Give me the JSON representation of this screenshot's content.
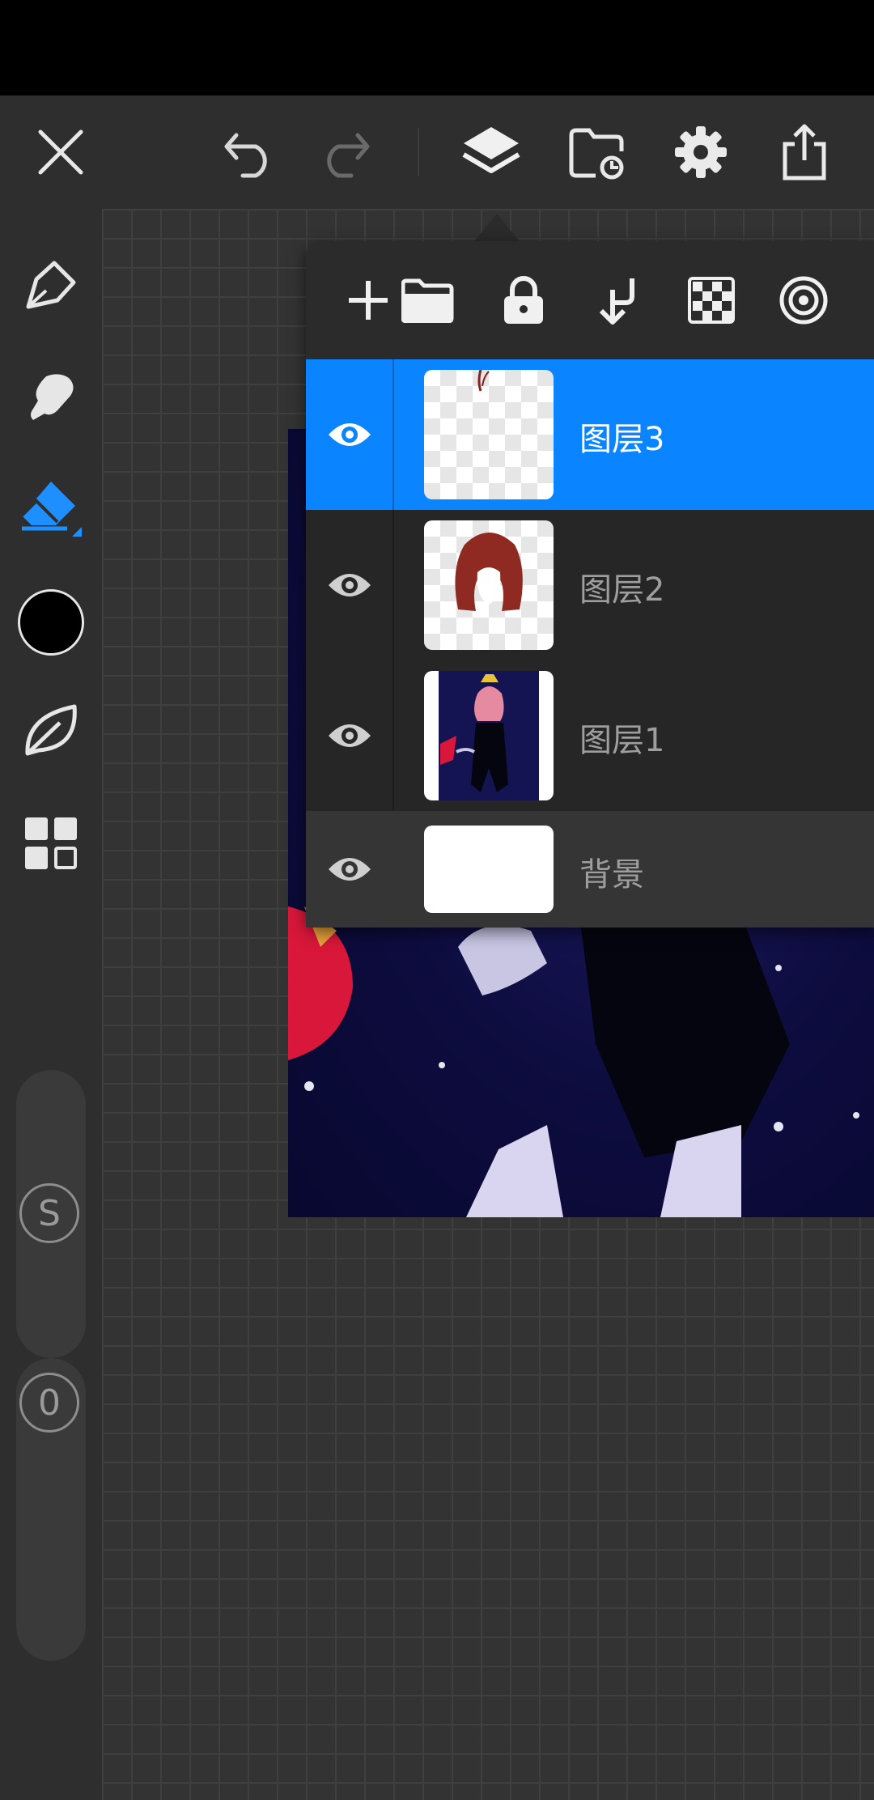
{
  "colors": {
    "accent": "#0a84ff",
    "toolbar": "#2e2e2e",
    "panel": "#2b2b2b"
  },
  "topbar": {
    "icons": [
      "close-icon",
      "undo-icon",
      "redo-icon",
      "layers-icon",
      "import-icon",
      "settings-icon",
      "share-icon"
    ]
  },
  "sidebar": {
    "tools": [
      "pen-icon",
      "smudge-icon",
      "eraser-icon",
      "color-swatch",
      "leaf-icon",
      "gallery-icon"
    ],
    "current_color": "#000000",
    "size_badge": "S",
    "opacity_badge": "0"
  },
  "layers_panel": {
    "toolbar": [
      "add-layer-icon",
      "folder-icon",
      "lock-icon",
      "merge-down-icon",
      "alpha-lock-icon",
      "clip-icon"
    ],
    "layers": [
      {
        "name": "图层3",
        "visible": true,
        "selected": true
      },
      {
        "name": "图层2",
        "visible": true,
        "selected": false
      },
      {
        "name": "图层1",
        "visible": true,
        "selected": false
      },
      {
        "name": "背景",
        "visible": true,
        "selected": false
      }
    ]
  }
}
